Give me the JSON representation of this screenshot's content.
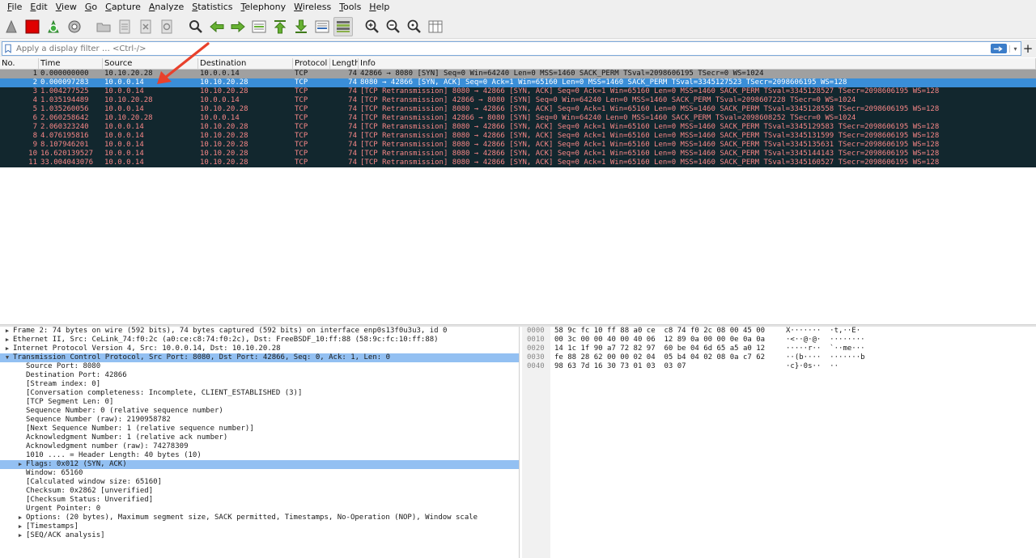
{
  "menu": [
    "File",
    "Edit",
    "View",
    "Go",
    "Capture",
    "Analyze",
    "Statistics",
    "Telephony",
    "Wireless",
    "Tools",
    "Help"
  ],
  "toolbar": {
    "icons": [
      "shark-fin-start-icon",
      "stop-capture-icon",
      "restart-capture-icon",
      "capture-options-icon",
      "open-file-icon",
      "save-file-icon",
      "close-file-icon",
      "reload-file-icon",
      "find-packet-icon",
      "go-back-icon",
      "go-forward-icon",
      "go-to-packet-icon",
      "go-first-packet-icon",
      "go-last-packet-icon",
      "auto-scroll-icon",
      "colorize-icon",
      "zoom-in-icon",
      "zoom-out-icon",
      "zoom-normal-icon",
      "resize-columns-icon"
    ]
  },
  "filter": {
    "placeholder": "Apply a display filter … <Ctrl-/>"
  },
  "packet_list": {
    "columns": [
      "No.",
      "Time",
      "Source",
      "Destination",
      "Protocol",
      "Length",
      "Info"
    ],
    "rows": [
      {
        "no": "1",
        "time": "0.000000000",
        "src": "10.10.20.28",
        "dst": "10.0.0.14",
        "proto": "TCP",
        "len": "74",
        "info": "42866 → 8080 [SYN] Seq=0 Win=64240 Len=0 MSS=1460 SACK_PERM TSval=2098606195 TSecr=0 WS=1024",
        "style": "normal"
      },
      {
        "no": "2",
        "time": "0.000097283",
        "src": "10.0.0.14",
        "dst": "10.10.20.28",
        "proto": "TCP",
        "len": "74",
        "info": "8080 → 42866 [SYN, ACK] Seq=0 Ack=1 Win=65160 Len=0 MSS=1460 SACK_PERM TSval=3345127523 TSecr=2098606195 WS=128",
        "style": "selected"
      },
      {
        "no": "3",
        "time": "1.004277525",
        "src": "10.0.0.14",
        "dst": "10.10.20.28",
        "proto": "TCP",
        "len": "74",
        "info": "[TCP Retransmission] 8080 → 42866 [SYN, ACK] Seq=0 Ack=1 Win=65160 Len=0 MSS=1460 SACK_PERM TSval=3345128527 TSecr=2098606195 WS=128",
        "style": "retrans"
      },
      {
        "no": "4",
        "time": "1.035194489",
        "src": "10.10.20.28",
        "dst": "10.0.0.14",
        "proto": "TCP",
        "len": "74",
        "info": "[TCP Retransmission] 42866 → 8080 [SYN] Seq=0 Win=64240 Len=0 MSS=1460 SACK_PERM TSval=2098607228 TSecr=0 WS=1024",
        "style": "retrans"
      },
      {
        "no": "5",
        "time": "1.035260056",
        "src": "10.0.0.14",
        "dst": "10.10.20.28",
        "proto": "TCP",
        "len": "74",
        "info": "[TCP Retransmission] 8080 → 42866 [SYN, ACK] Seq=0 Ack=1 Win=65160 Len=0 MSS=1460 SACK_PERM TSval=3345128558 TSecr=2098606195 WS=128",
        "style": "retrans"
      },
      {
        "no": "6",
        "time": "2.060258642",
        "src": "10.10.20.28",
        "dst": "10.0.0.14",
        "proto": "TCP",
        "len": "74",
        "info": "[TCP Retransmission] 42866 → 8080 [SYN] Seq=0 Win=64240 Len=0 MSS=1460 SACK_PERM TSval=2098608252 TSecr=0 WS=1024",
        "style": "retrans"
      },
      {
        "no": "7",
        "time": "2.060323240",
        "src": "10.0.0.14",
        "dst": "10.10.20.28",
        "proto": "TCP",
        "len": "74",
        "info": "[TCP Retransmission] 8080 → 42866 [SYN, ACK] Seq=0 Ack=1 Win=65160 Len=0 MSS=1460 SACK_PERM TSval=3345129583 TSecr=2098606195 WS=128",
        "style": "retrans"
      },
      {
        "no": "8",
        "time": "4.076195816",
        "src": "10.0.0.14",
        "dst": "10.10.20.28",
        "proto": "TCP",
        "len": "74",
        "info": "[TCP Retransmission] 8080 → 42866 [SYN, ACK] Seq=0 Ack=1 Win=65160 Len=0 MSS=1460 SACK_PERM TSval=3345131599 TSecr=2098606195 WS=128",
        "style": "retrans"
      },
      {
        "no": "9",
        "time": "8.107946201",
        "src": "10.0.0.14",
        "dst": "10.10.20.28",
        "proto": "TCP",
        "len": "74",
        "info": "[TCP Retransmission] 8080 → 42866 [SYN, ACK] Seq=0 Ack=1 Win=65160 Len=0 MSS=1460 SACK_PERM TSval=3345135631 TSecr=2098606195 WS=128",
        "style": "retrans"
      },
      {
        "no": "10",
        "time": "16.620139527",
        "src": "10.0.0.14",
        "dst": "10.10.20.28",
        "proto": "TCP",
        "len": "74",
        "info": "[TCP Retransmission] 8080 → 42866 [SYN, ACK] Seq=0 Ack=1 Win=65160 Len=0 MSS=1460 SACK_PERM TSval=3345144143 TSecr=2098606195 WS=128",
        "style": "retrans"
      },
      {
        "no": "11",
        "time": "33.004043076",
        "src": "10.0.0.14",
        "dst": "10.10.20.28",
        "proto": "TCP",
        "len": "74",
        "info": "[TCP Retransmission] 8080 → 42866 [SYN, ACK] Seq=0 Ack=1 Win=65160 Len=0 MSS=1460 SACK_PERM TSval=3345160527 TSecr=2098606195 WS=128",
        "style": "retrans"
      }
    ]
  },
  "details": [
    {
      "text": "Frame 2: 74 bytes on wire (592 bits), 74 bytes captured (592 bits) on interface enp0s13f0u3u3, id 0",
      "level": 0,
      "toggle": "collapsed"
    },
    {
      "text": "Ethernet II, Src: CeLink_74:f0:2c (a0:ce:c8:74:f0:2c), Dst: FreeBSDF_10:ff:88 (58:9c:fc:10:ff:88)",
      "level": 0,
      "toggle": "collapsed"
    },
    {
      "text": "Internet Protocol Version 4, Src: 10.0.0.14, Dst: 10.10.20.28",
      "level": 0,
      "toggle": "collapsed"
    },
    {
      "text": "Transmission Control Protocol, Src Port: 8080, Dst Port: 42866, Seq: 0, Ack: 1, Len: 0",
      "level": 0,
      "toggle": "expanded",
      "highlight": true
    },
    {
      "text": "Source Port: 8080",
      "level": 1,
      "toggle": "none"
    },
    {
      "text": "Destination Port: 42866",
      "level": 1,
      "toggle": "none"
    },
    {
      "text": "[Stream index: 0]",
      "level": 1,
      "toggle": "none"
    },
    {
      "text": "[Conversation completeness: Incomplete, CLIENT_ESTABLISHED (3)]",
      "level": 1,
      "toggle": "none"
    },
    {
      "text": "[TCP Segment Len: 0]",
      "level": 1,
      "toggle": "none"
    },
    {
      "text": "Sequence Number: 0    (relative sequence number)",
      "level": 1,
      "toggle": "none"
    },
    {
      "text": "Sequence Number (raw): 2190958782",
      "level": 1,
      "toggle": "none"
    },
    {
      "text": "[Next Sequence Number: 1    (relative sequence number)]",
      "level": 1,
      "toggle": "none"
    },
    {
      "text": "Acknowledgment Number: 1    (relative ack number)",
      "level": 1,
      "toggle": "none"
    },
    {
      "text": "Acknowledgment number (raw): 74278309",
      "level": 1,
      "toggle": "none"
    },
    {
      "text": "1010 .... = Header Length: 40 bytes (10)",
      "level": 1,
      "toggle": "none"
    },
    {
      "text": "Flags: 0x012 (SYN, ACK)",
      "level": 1,
      "toggle": "collapsed",
      "highlight": true
    },
    {
      "text": "Window: 65160",
      "level": 1,
      "toggle": "none"
    },
    {
      "text": "[Calculated window size: 65160]",
      "level": 1,
      "toggle": "none"
    },
    {
      "text": "Checksum: 0x2862 [unverified]",
      "level": 1,
      "toggle": "none"
    },
    {
      "text": "[Checksum Status: Unverified]",
      "level": 1,
      "toggle": "none"
    },
    {
      "text": "Urgent Pointer: 0",
      "level": 1,
      "toggle": "none"
    },
    {
      "text": "Options: (20 bytes), Maximum segment size, SACK permitted, Timestamps, No-Operation (NOP), Window scale",
      "level": 1,
      "toggle": "collapsed"
    },
    {
      "text": "[Timestamps]",
      "level": 1,
      "toggle": "collapsed"
    },
    {
      "text": "[SEQ/ACK analysis]",
      "level": 1,
      "toggle": "collapsed"
    }
  ],
  "bytes": [
    {
      "offset": "0000",
      "hex": "58 9c fc 10 ff 88 a0 ce  c8 74 f0 2c 08 00 45 00",
      "ascii": "X·······  ·t,··E·"
    },
    {
      "offset": "0010",
      "hex": "00 3c 00 00 40 00 40 06  12 89 0a 00 00 0e 0a 0a",
      "ascii": "·<··@·@·  ········"
    },
    {
      "offset": "0020",
      "hex": "14 1c 1f 90 a7 72 82 97  60 be 04 6d 65 a5 a0 12",
      "ascii": "·····r··  `··me···"
    },
    {
      "offset": "0030",
      "hex": "fe 88 28 62 00 00 02 04  05 b4 04 02 08 0a c7 62",
      "ascii": "··(b····  ·······b"
    },
    {
      "offset": "0040",
      "hex": "98 63 7d 16 30 73 01 03  03 07",
      "ascii": "·c}·0s··  ··"
    }
  ],
  "colors": {
    "selected_row": "#3a8ed8",
    "retrans_row_bg": "#12272e",
    "retrans_row_fg": "#f78787",
    "normal_row_bg": "#a0a0a0",
    "annotation_arrow": "#e8412c",
    "detail_highlight": "#93c0f2"
  }
}
